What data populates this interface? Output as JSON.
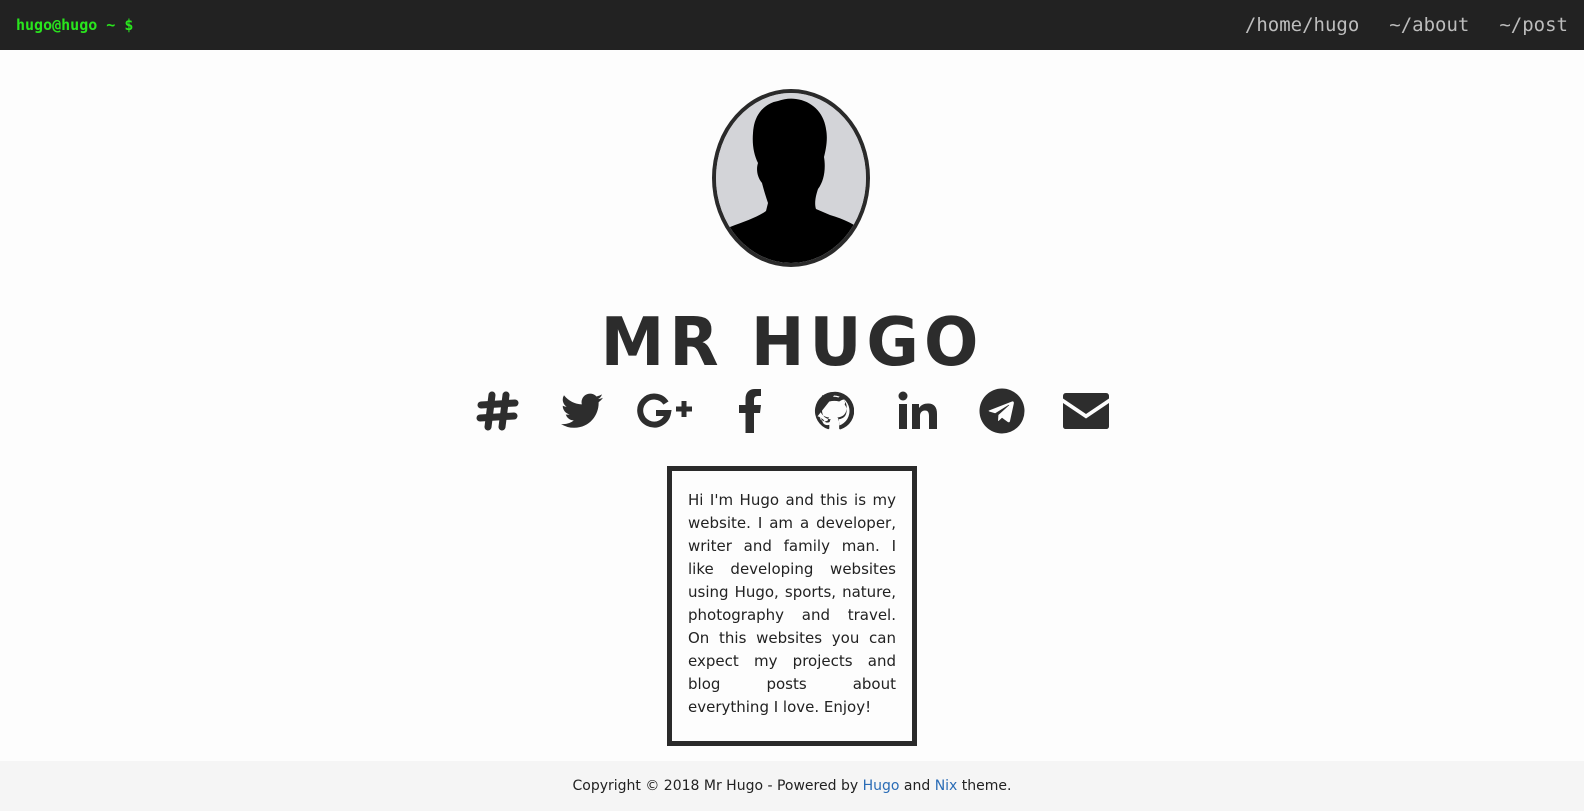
{
  "header": {
    "prompt": "hugo@hugo ~ $",
    "nav": [
      {
        "label": "/home/hugo"
      },
      {
        "label": "~/about"
      },
      {
        "label": "~/post"
      }
    ]
  },
  "profile": {
    "name": "MR HUGO",
    "avatar_icon": "person-silhouette-icon"
  },
  "socials": [
    {
      "icon": "slack-icon"
    },
    {
      "icon": "twitter-icon"
    },
    {
      "icon": "google-plus-icon"
    },
    {
      "icon": "facebook-icon"
    },
    {
      "icon": "github-icon"
    },
    {
      "icon": "linkedin-icon"
    },
    {
      "icon": "telegram-icon"
    },
    {
      "icon": "email-icon"
    }
  ],
  "bio": {
    "text": "Hi I'm Hugo and this is my website. I am a developer, writer and family man. I like developing websites using Hugo, sports, nature, photography and travel. On this websites you can expect my projects and blog posts about everything I love. Enjoy!"
  },
  "footer": {
    "prefix": "Copyright © 2018 Mr Hugo - Powered by ",
    "hugo_link": "Hugo",
    "middle": " and ",
    "nix_link": "Nix",
    "suffix": " theme."
  },
  "colors": {
    "topbar_bg": "#222222",
    "prompt_green": "#29e51d",
    "nav_text": "#bdbdbd",
    "link_blue": "#2a6cb6",
    "footer_bg": "#f5f5f5"
  }
}
